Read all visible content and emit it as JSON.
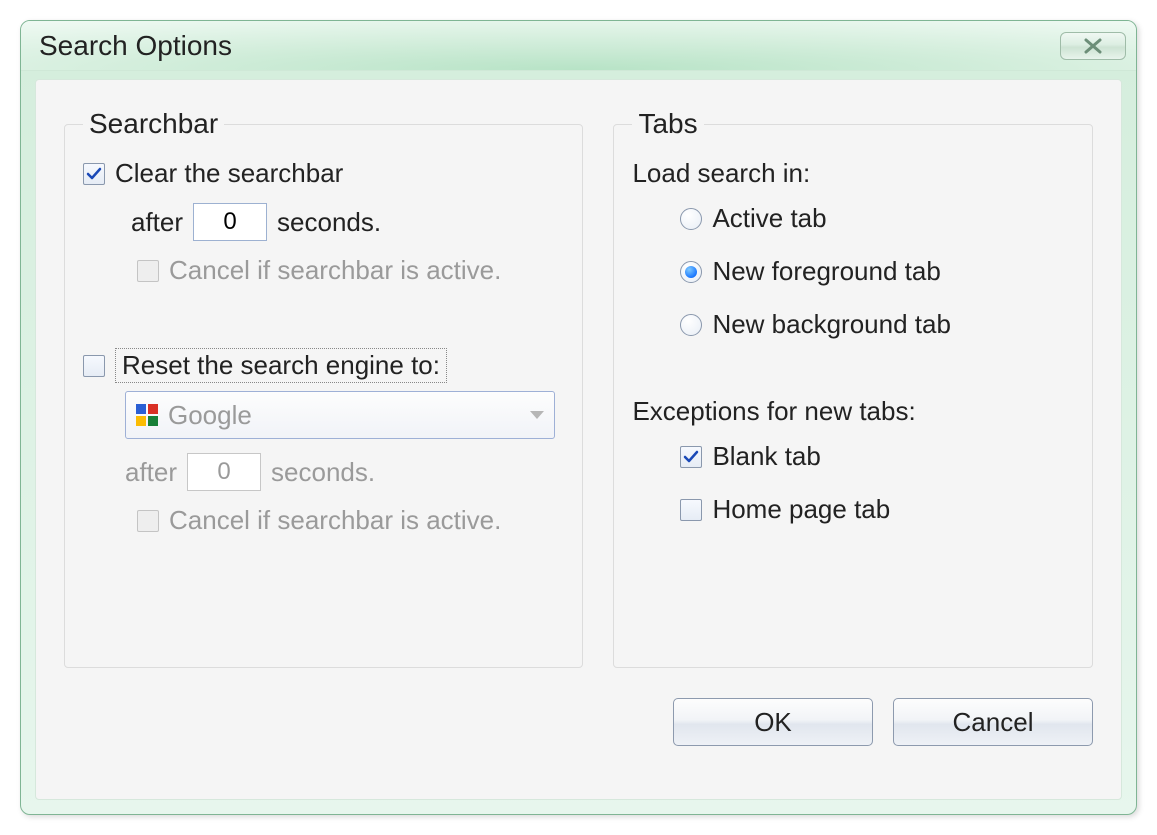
{
  "window": {
    "title": "Search Options"
  },
  "searchbar": {
    "legend": "Searchbar",
    "clear": {
      "label": "Clear the searchbar",
      "checked": true,
      "after_label": "after",
      "seconds_value": "0",
      "seconds_suffix": "seconds.",
      "cancel_label": "Cancel if searchbar is active.",
      "cancel_checked": false,
      "cancel_enabled": false
    },
    "reset": {
      "label": "Reset the search engine to:",
      "checked": false,
      "engine": "Google",
      "after_label": "after",
      "seconds_value": "0",
      "seconds_suffix": "seconds.",
      "cancel_label": "Cancel if searchbar is active.",
      "cancel_checked": false,
      "enabled": false
    }
  },
  "tabs": {
    "legend": "Tabs",
    "load_heading": "Load search in:",
    "options": {
      "active": {
        "label": "Active tab",
        "checked": false
      },
      "newfg": {
        "label": "New foreground tab",
        "checked": true
      },
      "newbg": {
        "label": "New background tab",
        "checked": false
      }
    },
    "exceptions_heading": "Exceptions for new tabs:",
    "exceptions": {
      "blank": {
        "label": "Blank tab",
        "checked": true
      },
      "home": {
        "label": "Home page tab",
        "checked": false
      }
    }
  },
  "buttons": {
    "ok": "OK",
    "cancel": "Cancel"
  }
}
